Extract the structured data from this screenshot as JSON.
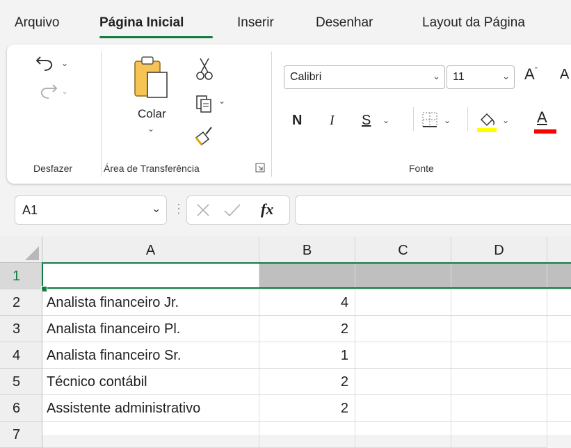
{
  "tabs": [
    {
      "label": "Arquivo"
    },
    {
      "label": "Página Inicial"
    },
    {
      "label": "Inserir"
    },
    {
      "label": "Desenhar"
    },
    {
      "label": "Layout da Página"
    }
  ],
  "ribbon": {
    "undo_group": {
      "label": "Desfazer",
      "undo_icon": "undo-icon",
      "redo_icon": "redo-icon"
    },
    "clipboard_group": {
      "label": "Área de Transferência",
      "paste_label": "Colar",
      "cut_icon": "scissors-icon",
      "copy_icon": "copy-icon",
      "format_painter_icon": "format-painter-icon"
    },
    "font_group": {
      "label": "Fonte",
      "font_name": "Calibri",
      "font_size": "11",
      "bold": "N",
      "italic": "I",
      "underline": "S",
      "fill_color": "#ffff00",
      "font_color": "#ff0000",
      "font_color_letter": "A"
    }
  },
  "formula_bar": {
    "name_box": "A1",
    "fx_label": "fx",
    "formula": ""
  },
  "sheet": {
    "columns": [
      "A",
      "B",
      "C",
      "D"
    ],
    "rows": [
      {
        "num": "1",
        "a": "",
        "b": ""
      },
      {
        "num": "2",
        "a": "Analista financeiro Jr.",
        "b": "4"
      },
      {
        "num": "3",
        "a": "Analista financeiro Pl.",
        "b": "2"
      },
      {
        "num": "4",
        "a": "Analista financeiro Sr.",
        "b": "1"
      },
      {
        "num": "5",
        "a": "Técnico contábil",
        "b": "2"
      },
      {
        "num": "6",
        "a": "Assistente administrativo",
        "b": "2"
      },
      {
        "num": "7",
        "a": "",
        "b": ""
      }
    ]
  },
  "colors": {
    "accent": "#107c41",
    "header_fill": "#bfbfbf"
  }
}
